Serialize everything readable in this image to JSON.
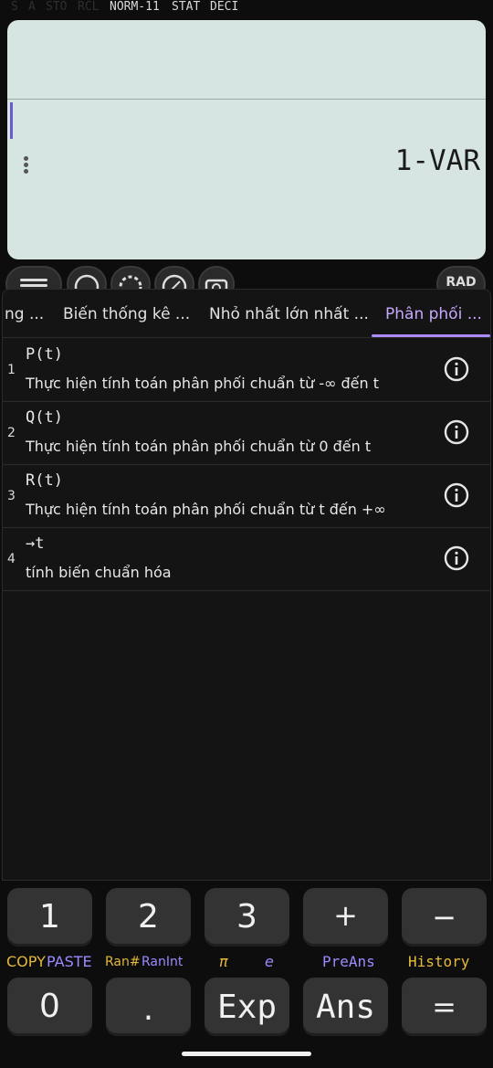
{
  "status": {
    "flags_dim": [
      "S",
      "A",
      "STO",
      "RCL"
    ],
    "flags_active": [
      "NORM-11",
      "STAT",
      "DECI"
    ]
  },
  "display": {
    "result": "1-VAR"
  },
  "toolbar": {
    "icons": [
      "menu-icon",
      "sigma-icon",
      "settings-icon",
      "plus-minus-icon",
      "camera-icon"
    ],
    "angle_mode": "RAD"
  },
  "tabs": [
    "ng ...",
    "Biến thống kê ...",
    "Nhỏ nhất lớn nhất ...",
    "Phân phối ..."
  ],
  "active_tab": 3,
  "functions": [
    {
      "index": "1",
      "name": "P(t)",
      "desc": "Thực hiện tính toán phân phối chuẩn từ -∞ đến t"
    },
    {
      "index": "2",
      "name": "Q(t)",
      "desc": "Thực hiện tính toán phân phối chuẩn từ 0 đến t"
    },
    {
      "index": "3",
      "name": "R(t)",
      "desc": "Thực hiện tính toán phân phối chuẩn từ t đến +∞"
    },
    {
      "index": "4",
      "name": "→t",
      "desc": "tính biến chuẩn hóa"
    }
  ],
  "keys_row1": [
    "1",
    "2",
    "3",
    "+",
    "−"
  ],
  "sublabels": {
    "copy": "COPY",
    "paste": "PASTE",
    "ran": "Ran#",
    "ranint": "RanInt",
    "pi": "π",
    "e": "e",
    "preans": "PreAns",
    "history": "History"
  },
  "keys_row2": [
    "0",
    ".",
    "Exp",
    "Ans",
    "="
  ],
  "colors": {
    "accent": "#a98bff",
    "gold": "#e5b93a",
    "display_bg": "#d6e4e2"
  }
}
